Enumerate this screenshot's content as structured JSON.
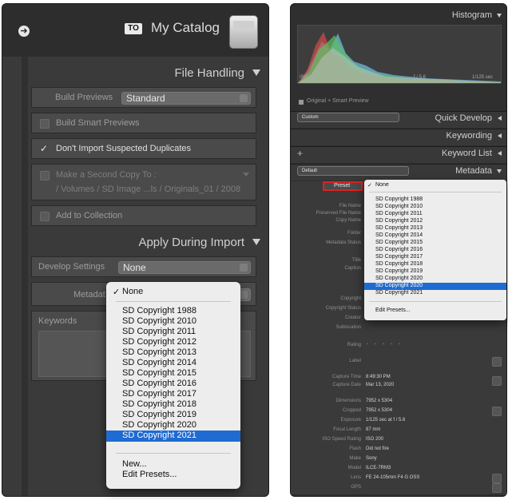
{
  "left": {
    "catalog_badge": "TO",
    "catalog_name": "My Catalog",
    "file_handling_title": "File Handling",
    "build_previews_label": "Build Previews",
    "build_previews_value": "Standard",
    "smart_previews_label": "Build Smart Previews",
    "dont_import_label": "Don't Import Suspected Duplicates",
    "second_copy_label": "Make a Second Copy To :",
    "second_copy_path": "/ Volumes / SD Image ...ls / Originals_01 / 2008",
    "add_collection_label": "Add to Collection",
    "apply_title": "Apply During Import",
    "develop_label": "Develop Settings",
    "develop_value": "None",
    "metadata_label": "Metadat",
    "keywords_label": "Keywords",
    "check_mark": "✓",
    "menu": {
      "items": [
        "None",
        "SD Copyright 1988",
        "SD Copyright 2010",
        "SD Copyright 2011",
        "SD Copyright 2012",
        "SD Copyright 2013",
        "SD Copyright 2014",
        "SD Copyright 2015",
        "SD Copyright 2016",
        "SD Copyright 2017",
        "SD Copyright 2018",
        "SD Copyright 2019",
        "SD Copyright 2020",
        "SD Copyright 2021"
      ],
      "new": "New...",
      "edit": "Edit Presets..."
    }
  },
  "right": {
    "histogram_title": "Histogram",
    "hist_iso": "ISO 200",
    "hist_focal": "87 mm",
    "hist_aperture": "f / 5.6",
    "hist_shutter": "1/125 sec",
    "original_label": "Original + Smart Preview",
    "custom_label": "Custom",
    "quick_develop": "Quick Develop",
    "keywording": "Keywording",
    "keyword_list": "Keyword List",
    "plus": "+",
    "default_label": "Default",
    "metadata_title": "Metadata",
    "preset_label": "Preset",
    "menu": {
      "items": [
        "None",
        "SD Copyright 1988",
        "SD Copyright 2010",
        "SD Copyright 2011",
        "SD Copyright 2012",
        "SD Copyright 2013",
        "SD Copyright 2014",
        "SD Copyright 2015",
        "SD Copyright 2016",
        "SD Copyright 2017",
        "SD Copyright 2018",
        "SD Copyright 2019",
        "SD Copyright 2020",
        "SD Copyright 2021"
      ],
      "edit": "Edit Presets..."
    },
    "field_labels": [
      "File Name",
      "Preserved File Name",
      "Copy Name",
      "Folder",
      "Metadata Status",
      "Title",
      "Caption",
      "Copyright",
      "Copyright Status",
      "Creator",
      "Sublocation",
      "Rating",
      "Label"
    ],
    "capture": [
      {
        "label": "Capture Time",
        "value": "8:49:30 PM"
      },
      {
        "label": "Capture Date",
        "value": "Mar 13, 2020"
      },
      {
        "label": "Dimensions",
        "value": "7952 x 5304"
      },
      {
        "label": "Cropped",
        "value": "7952 x 5304"
      },
      {
        "label": "Exposure",
        "value": "1/125 sec at f / 5.6"
      },
      {
        "label": "Focal Length",
        "value": "87 mm"
      },
      {
        "label": "ISO Speed Rating",
        "value": "ISO 200"
      },
      {
        "label": "Flash",
        "value": "Did not fire"
      },
      {
        "label": "Make",
        "value": "Sony"
      },
      {
        "label": "Model",
        "value": "ILCE-7RM3"
      },
      {
        "label": "Lens",
        "value": "FE 24-105mm F4 G OSS"
      },
      {
        "label": "GPS",
        "value": ""
      }
    ],
    "rating_stars": "· · · · ·"
  }
}
